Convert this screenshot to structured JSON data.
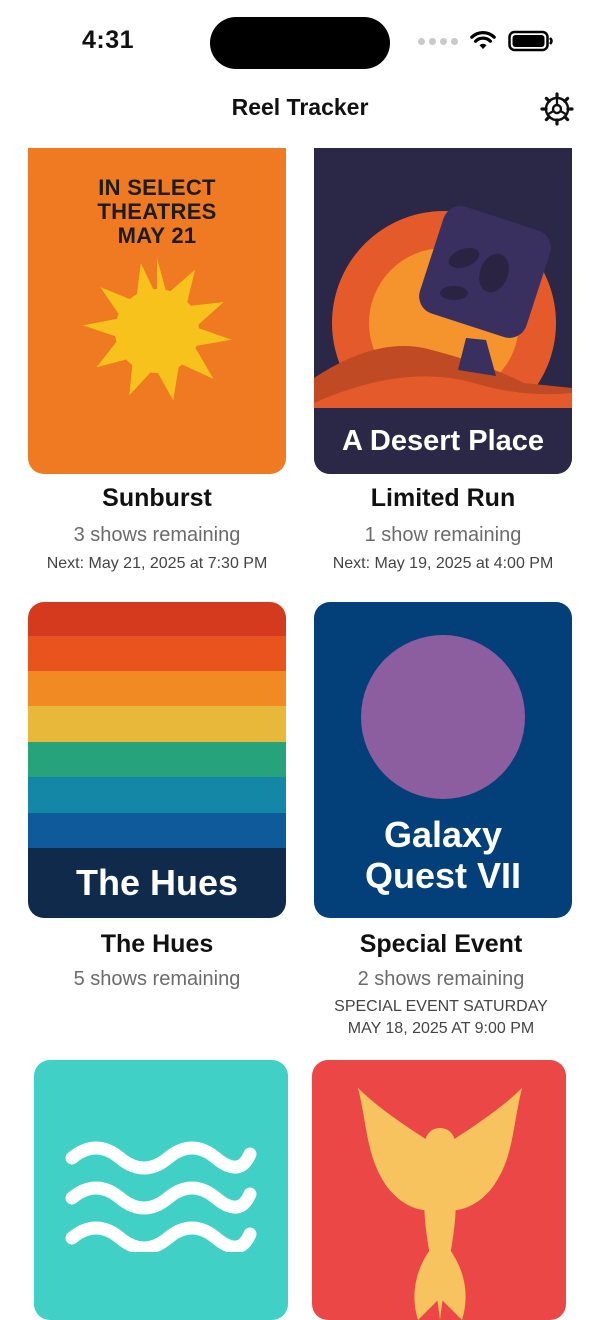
{
  "status_bar": {
    "time": "4:31"
  },
  "header": {
    "title": "Reel Tracker"
  },
  "cards": [
    {
      "title": "Sunburst",
      "remaining": "3 shows remaining",
      "next": "Next: May 21, 2025 at 7:30 PM",
      "poster_text_1": "IN SELECT",
      "poster_text_2": "THEATRES",
      "poster_text_3": "MAY 21"
    },
    {
      "title": "Limited Run",
      "remaining": "1 show remaining",
      "next": "Next: May 19, 2025 at 4:00 PM",
      "poster_text": "A Desert Place"
    },
    {
      "title": "The Hues",
      "remaining": "5 shows remaining",
      "poster_text": "The Hues"
    },
    {
      "title": "Special Event",
      "remaining": "2 shows remaining",
      "event_line_1": "SPECIAL EVENT SATURDAY",
      "event_line_2": "MAY 18, 2025 AT 9:00 PM",
      "poster_text_1": "Galaxy",
      "poster_text_2": "Quest VII"
    },
    {
      "icon": "waves-icon"
    },
    {
      "icon": "phoenix-icon"
    }
  ],
  "colors": {
    "sunburst_bg": "#f07a22",
    "desert_bg": "#2a2747",
    "galaxy_bg": "#033f79",
    "waves_bg": "#40d0c6",
    "phoenix_bg": "#ea4746",
    "sun": "#f7c21b"
  }
}
